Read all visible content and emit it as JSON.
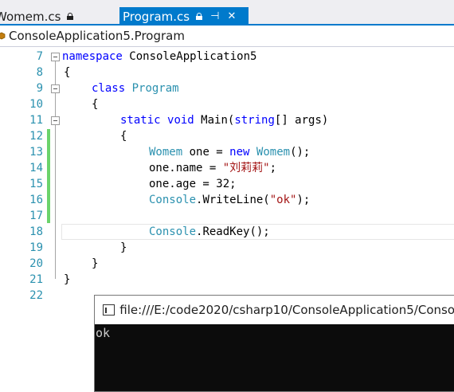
{
  "tabs": [
    {
      "label": "Womem.cs",
      "active": false
    },
    {
      "label": "Program.cs",
      "active": true
    }
  ],
  "navbar": {
    "class_path": "ConsoleApplication5.Program"
  },
  "editor": {
    "lines": [
      {
        "num": "7",
        "code": "namespace ConsoleApplication5"
      },
      {
        "num": "8",
        "code": "{"
      },
      {
        "num": "9",
        "code": "class Program"
      },
      {
        "num": "10",
        "code": "{"
      },
      {
        "num": "11",
        "code": "static void Main(string[] args)"
      },
      {
        "num": "12",
        "code": "{"
      },
      {
        "num": "13",
        "code": "Womem one = new Womem();"
      },
      {
        "num": "14",
        "code": "one.name = \"刘莉莉\";"
      },
      {
        "num": "15",
        "code": "one.age = 32;"
      },
      {
        "num": "16",
        "code": "Console.WriteLine(\"ok\");"
      },
      {
        "num": "17",
        "code": ""
      },
      {
        "num": "18",
        "code": "Console.ReadKey();"
      },
      {
        "num": "19",
        "code": "}"
      },
      {
        "num": "20",
        "code": "}"
      },
      {
        "num": "21",
        "code": "}"
      },
      {
        "num": "22",
        "code": ""
      }
    ]
  },
  "console": {
    "title": "file:///E:/code2020/csharp10/ConsoleApplication5/Conso",
    "output": "ok"
  },
  "colors": {
    "tab_active": "#007acc",
    "keyword": "#0000ff",
    "type": "#2b91af",
    "string": "#a31515",
    "change_bar": "#6bd36b"
  }
}
